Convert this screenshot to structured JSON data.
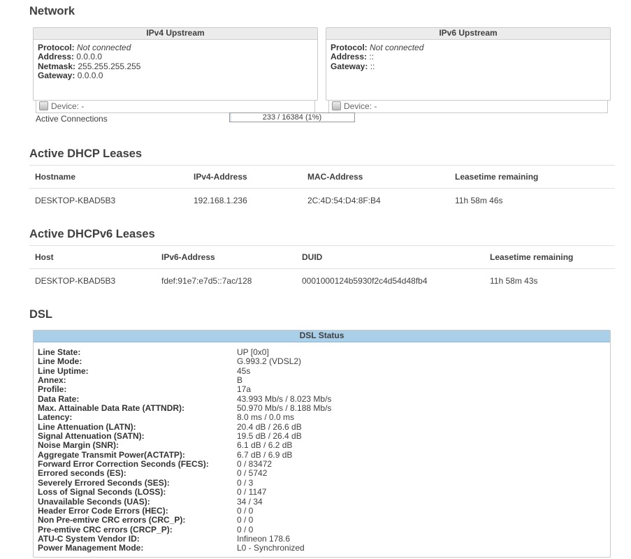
{
  "network": {
    "title": "Network",
    "ipv4": {
      "title": "IPv4 Upstream",
      "rows": [
        {
          "label": "Protocol:",
          "value": "Not connected"
        },
        {
          "label": "Address:",
          "value": "0.0.0.0"
        },
        {
          "label": "Netmask:",
          "value": "255.255.255.255"
        },
        {
          "label": "Gateway:",
          "value": "0.0.0.0"
        }
      ],
      "device": "Device: -"
    },
    "ipv6": {
      "title": "IPv6 Upstream",
      "rows": [
        {
          "label": "Protocol:",
          "value": "Not connected"
        },
        {
          "label": "Address:",
          "value": "::"
        },
        {
          "label": "Gateway:",
          "value": "::"
        }
      ],
      "device": "Device: -"
    },
    "connections": {
      "label": "Active Connections",
      "text": "233 / 16384 (1%)",
      "fraction": 0.014
    }
  },
  "dhcp": {
    "title": "Active DHCP Leases",
    "headers": [
      "Hostname",
      "IPv4-Address",
      "MAC-Address",
      "Leasetime remaining"
    ],
    "rows": [
      [
        "DESKTOP-KBAD5B3",
        "192.168.1.236",
        "2C:4D:54:D4:8F:B4",
        "11h 58m 46s"
      ]
    ]
  },
  "dhcp6": {
    "title": "Active DHCPv6 Leases",
    "headers": [
      "Host",
      "IPv6-Address",
      "DUID",
      "Leasetime remaining"
    ],
    "rows": [
      [
        "DESKTOP-KBAD5B3",
        "fdef:91e7:e7d5::7ac/128",
        "0001000124b5930f2c4d54d48fb4",
        "11h 58m 43s"
      ]
    ]
  },
  "dsl": {
    "title": "DSL",
    "panel_title": "DSL Status",
    "rows": [
      {
        "label": "Line State:",
        "value": "UP [0x0]"
      },
      {
        "label": "Line Mode:",
        "value": "G.993.2 (VDSL2)"
      },
      {
        "label": "Line Uptime:",
        "value": "45s"
      },
      {
        "label": "Annex:",
        "value": "B"
      },
      {
        "label": "Profile:",
        "value": "17a"
      },
      {
        "label": "Data Rate:",
        "value": "43.993 Mb/s / 8.023 Mb/s"
      },
      {
        "label": "Max. Attainable Data Rate (ATTNDR):",
        "value": "50.970 Mb/s / 8.188 Mb/s"
      },
      {
        "label": "Latency:",
        "value": "8.0 ms / 0.0 ms"
      },
      {
        "label": "Line Attenuation (LATN):",
        "value": "20.4 dB / 26.6 dB"
      },
      {
        "label": "Signal Attenuation (SATN):",
        "value": "19.5 dB / 26.4 dB"
      },
      {
        "label": "Noise Margin (SNR):",
        "value": "6.1 dB / 6.2 dB"
      },
      {
        "label": "Aggregate Transmit Power(ACTATP):",
        "value": "6.7 dB / 6.9 dB"
      },
      {
        "label": "Forward Error Correction Seconds (FECS):",
        "value": "0 / 83472"
      },
      {
        "label": "Errored seconds (ES):",
        "value": "0 / 5742"
      },
      {
        "label": "Severely Errored Seconds (SES):",
        "value": "0 / 3"
      },
      {
        "label": "Loss of Signal Seconds (LOSS):",
        "value": "0 / 1147"
      },
      {
        "label": "Unavailable Seconds (UAS):",
        "value": "34 / 34"
      },
      {
        "label": "Header Error Code Errors (HEC):",
        "value": "0 / 0"
      },
      {
        "label": "Non Pre-emtive CRC errors (CRC_P):",
        "value": "0 / 0"
      },
      {
        "label": "Pre-emtive CRC errors (CRCP_P):",
        "value": "0 / 0"
      },
      {
        "label": "ATU-C System Vendor ID:",
        "value": "Infineon 178.6"
      },
      {
        "label": "Power Management Mode:",
        "value": "L0 - Synchronized"
      }
    ]
  }
}
